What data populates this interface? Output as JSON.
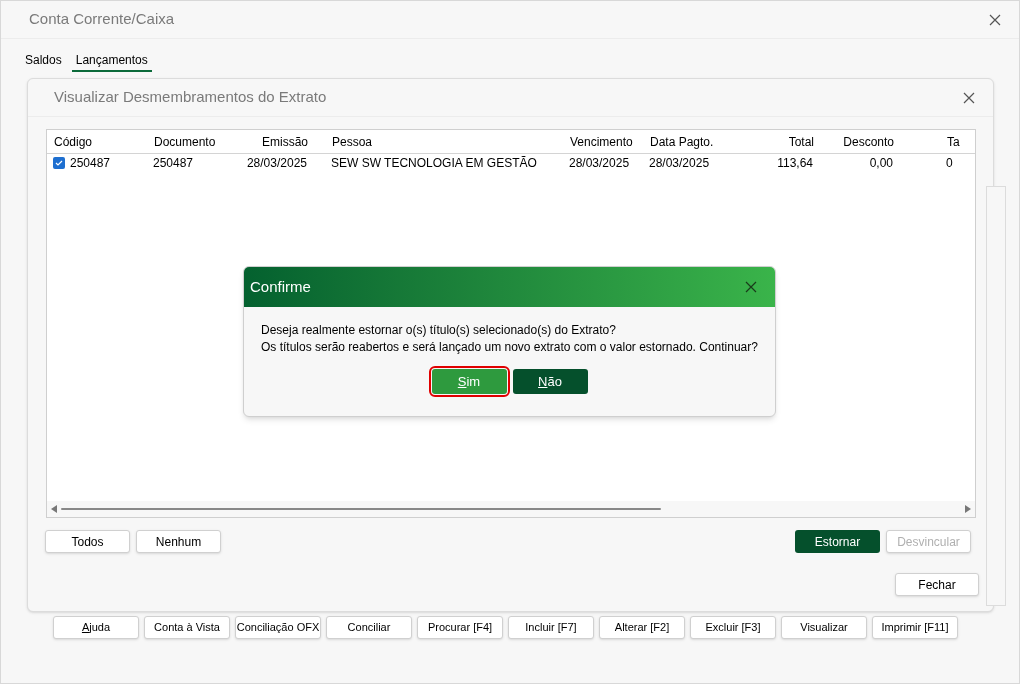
{
  "window": {
    "title": "Conta Corrente/Caixa"
  },
  "tabs": [
    {
      "label": "Saldos",
      "selected": false
    },
    {
      "label": "Lançamentos",
      "selected": true
    }
  ],
  "panel": {
    "title": "Visualizar Desmembramentos do Extrato"
  },
  "table": {
    "columns": [
      "Código",
      "Documento",
      "Emissão",
      "Pessoa",
      "Vencimento",
      "Data Pagto.",
      "Total",
      "Desconto",
      "Ta"
    ],
    "rows": [
      {
        "checked": true,
        "cells": [
          "250487",
          "250487",
          "28/03/2025",
          "SEW SW TECNOLOGIA EM GESTÃO",
          "28/03/2025",
          "28/03/2025",
          "113,64",
          "0,00",
          "0"
        ]
      }
    ]
  },
  "panel_buttons": [
    {
      "label": "Todos",
      "kind": "plain",
      "disabled": false
    },
    {
      "label": "Nenhum",
      "kind": "plain",
      "disabled": false
    },
    {
      "label": "Estornar",
      "kind": "primary",
      "disabled": false
    },
    {
      "label": "Desvincular",
      "kind": "plain",
      "disabled": true
    }
  ],
  "close_button": {
    "label": "Fechar"
  },
  "toolbar": [
    {
      "label": "Ajuda",
      "underline_first": true
    },
    {
      "label": "Conta à Vista",
      "underline_first": false
    },
    {
      "label": "Conciliação OFX",
      "underline_first": false
    },
    {
      "label": "Conciliar",
      "underline_first": false
    },
    {
      "label": "Procurar [F4]",
      "underline_first": false
    },
    {
      "label": "Incluir [F7]",
      "underline_first": false
    },
    {
      "label": "Alterar [F2]",
      "underline_first": false
    },
    {
      "label": "Excluir [F3]",
      "underline_first": false
    },
    {
      "label": "Visualizar",
      "underline_first": false
    },
    {
      "label": "Imprimir [F11]",
      "underline_first": false
    }
  ],
  "dialog": {
    "title": "Confirme",
    "lines": [
      "Deseja realmente estornar o(s) título(s) selecionado(s) do Extrato?",
      "Os títulos serão reabertos e será lançado um novo extrato com o valor estornado. Continuar?"
    ],
    "buttons": [
      {
        "label": "Sim",
        "kind": "light",
        "focused": true,
        "underline_first": true
      },
      {
        "label": "Não",
        "kind": "dark",
        "focused": false,
        "underline_first": true
      }
    ]
  }
}
